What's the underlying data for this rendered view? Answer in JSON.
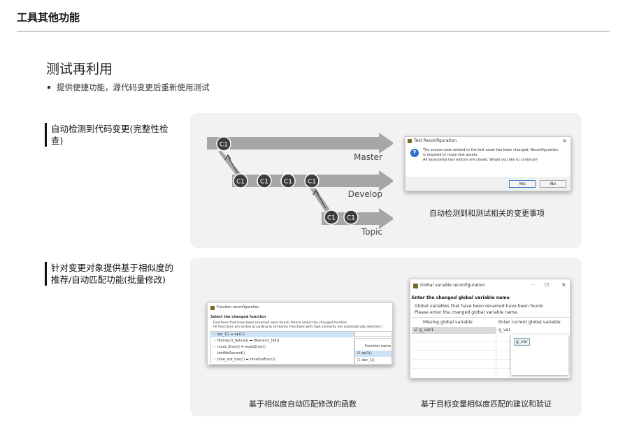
{
  "header": {
    "title": "工具其他功能"
  },
  "section": {
    "title": "测试再利用",
    "bullet": "提供便捷功能，源代码变更后重新使用测试"
  },
  "row1": {
    "label": "自动检测到代码变更(完整性检查)",
    "branches": {
      "master": "Master",
      "develop": "Develop",
      "topic": "Topic",
      "commit": "C1"
    },
    "dialog": {
      "title": "Test Reconfiguration",
      "line1": "The source code related to the test asset has been changed. Reconfiguration",
      "line2": "is required to reuse test assets.",
      "line3": "All associated test editors are closed. Would you like to continue?",
      "yes": "Yes",
      "no": "No",
      "close": "×"
    },
    "caption": "自动检测到和测试相关的变更事项"
  },
  "row2": {
    "label": "针对变更对象提供基于相似度的推荐/自动匹配功能(批量修改)",
    "func_dialog": {
      "title": "Function reconfiguration",
      "heading": "Select the changed function",
      "desc1": "Functions that have been renamed were found. Please select the changed function.",
      "desc2": "(※ Functions are sorted according to similarity. Functions with high similarity are automatically selected.)",
      "items": [
        "api_1() ➡ api1()",
        "fibonacci_failure() ➡ fibonacci_fail()",
        "mcdc_Error() ➡ mcdcError()",
        "testMeSecond()",
        "time_out_func() ➡ timeOutFunc()"
      ],
      "col_header": "Function name",
      "options": [
        "api1()",
        "abc_1()"
      ]
    },
    "gvar_dialog": {
      "title": "Global variable reconfiguration",
      "heading": "Enter the changed global variable name",
      "desc1": "Global variables that have been renamed have been found.",
      "desc2": "Please enter the changed global variable name.",
      "col_missing": "Missing global variable",
      "col_current": "Enter current global variable",
      "missing_value": "g_var1",
      "current_value": "g_var",
      "suggestion": "g_var",
      "minimize": "—",
      "maximize": "☐",
      "close": "×"
    },
    "caption_left": "基于相似度自动匹配修改的函数",
    "caption_right": "基于目标变量相似度匹配的建议和验证"
  },
  "colors": {
    "branch": "#a6a6a6",
    "commit": "#3d3d3d",
    "accent": "#2c6fc9"
  }
}
